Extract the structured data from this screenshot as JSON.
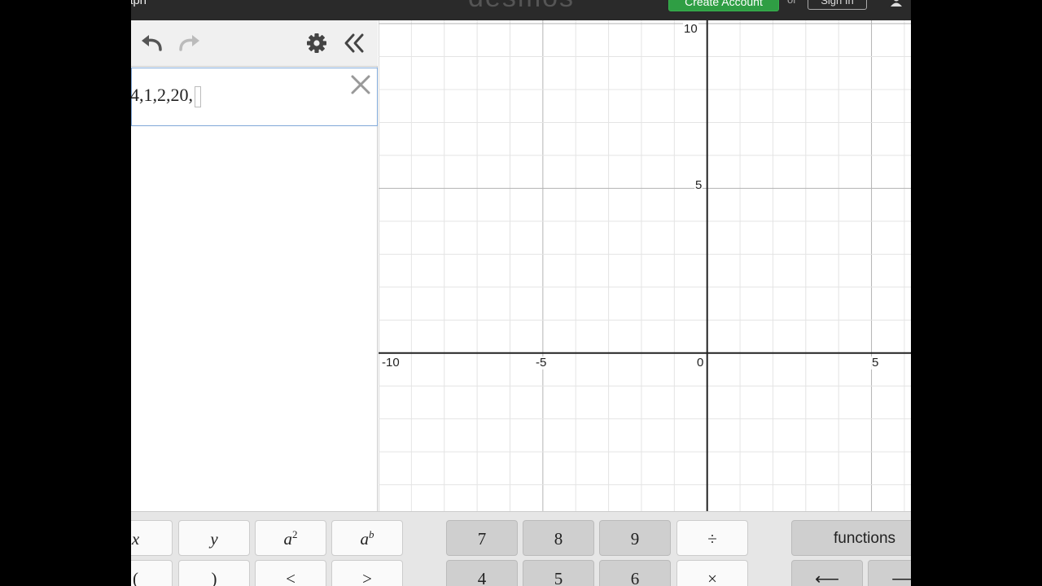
{
  "header": {
    "title": "aph",
    "brand": "desmos",
    "create_account": "Create Account",
    "or": "or",
    "sign_in": "Sign In"
  },
  "expression_list": {
    "expressions": [
      {
        "latex_visible": "4,1,2,20,"
      }
    ]
  },
  "graph": {
    "x_range": [
      -10,
      6.2
    ],
    "y_range": [
      -4.8,
      10.1
    ],
    "grid": true,
    "x_tick_labels": [
      "-10",
      "-5",
      "0",
      "5"
    ],
    "y_tick_labels": [
      "10",
      "5"
    ]
  },
  "keypad": {
    "row1": {
      "x": "x",
      "y": "y",
      "a": "a",
      "sq": "2",
      "b": "b",
      "seven": "7",
      "eight": "8",
      "nine": "9",
      "divide": "÷",
      "functions": "functions"
    },
    "row2": {
      "lparen": "(",
      "rparen": ")",
      "lt": "<",
      "gt": ">",
      "four": "4",
      "five": "5",
      "six": "6",
      "times": "×",
      "left": "⟵",
      "right": "⟶"
    }
  },
  "colors": {
    "create_account_bg": "#2f9e44",
    "expression_border": "#7fa7d7",
    "keypad_bg": "#e6e6e6"
  }
}
